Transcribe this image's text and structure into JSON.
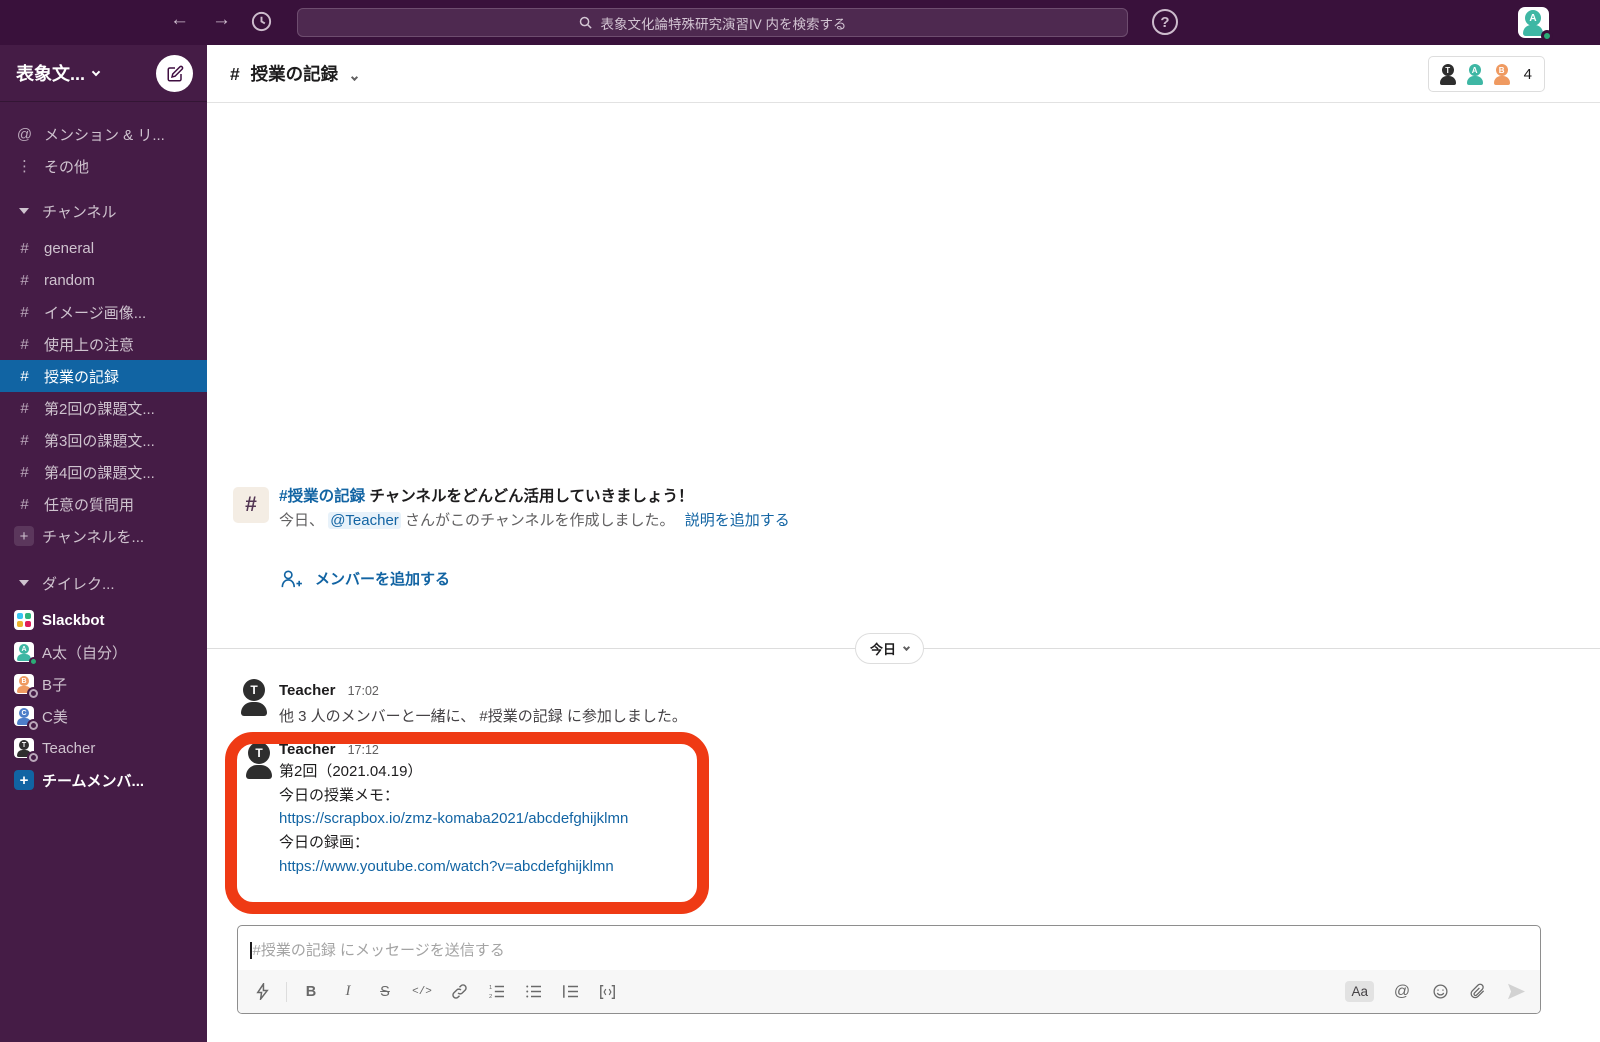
{
  "glyphs": {
    "hash": "#",
    "at": "@",
    "dots": "⋮",
    "plus": "+",
    "question": "?",
    "back": "←",
    "forward": "→",
    "bold": "B",
    "italic": "I",
    "strike": "S",
    "code": "</>"
  },
  "topbar": {
    "search_text": "表象文化論特殊研究演習IV 内を検索する",
    "avatar_letter": "A"
  },
  "sidebar": {
    "workspace_name": "表象文...",
    "mentions_label": "メンション & リ...",
    "more_label": "その他",
    "channels_section": "チャンネル",
    "channels": [
      {
        "label": "general"
      },
      {
        "label": "random"
      },
      {
        "label": "イメージ画像..."
      },
      {
        "label": "使用上の注意"
      },
      {
        "label": "授業の記録"
      },
      {
        "label": "第2回の課題文..."
      },
      {
        "label": "第3回の課題文..."
      },
      {
        "label": "第4回の課題文..."
      },
      {
        "label": "任意の質問用"
      }
    ],
    "add_channel_label": "チャンネルを...",
    "dm_section": "ダイレク...",
    "dms": [
      {
        "name": "Slackbot"
      },
      {
        "name": "A太（自分）",
        "letter": "A"
      },
      {
        "name": "B子",
        "letter": "B"
      },
      {
        "name": "C美",
        "letter": "C"
      },
      {
        "name": "Teacher",
        "letter": "T"
      }
    ],
    "add_member_label": "チームメンバ..."
  },
  "header": {
    "channel_name": "授業の記録",
    "member_count": "4",
    "member_letters": [
      "T",
      "A",
      "B"
    ]
  },
  "intro": {
    "channel_link": "#授業の記録",
    "title_rest": " チャンネルをどんどん活用していきましょう！",
    "desc_prefix": "今日、",
    "mention": "@Teacher",
    "desc_suffix": " さんがこのチャンネルを作成しました。",
    "add_description_link": "説明を追加する",
    "add_members_label": "メンバーを追加する"
  },
  "day_divider": {
    "label": "今日"
  },
  "messages": [
    {
      "author": "Teacher",
      "time": "17:02",
      "avatar_letter": "T",
      "text": "他 3 人のメンバーと一緒に、 #授業の記録 に参加しました。"
    },
    {
      "author": "Teacher",
      "time": "17:12",
      "avatar_letter": "T",
      "lines": [
        "第2回（2021.04.19）",
        "今日の授業メモ：",
        "https://scrapbox.io/zmz-komaba2021/abcdefghijklmn",
        "今日の録画：",
        "https://www.youtube.com/watch?v=abcdefghijklmn"
      ]
    }
  ],
  "composer": {
    "placeholder": "#授業の記録 にメッセージを送信する",
    "aa_label": "Aa"
  },
  "colors": {
    "topbar": "#39113B",
    "sidebar": "#451C46",
    "selected_blue": "#1164A3",
    "link_blue": "#1264A3",
    "annotation_red": "#EF3A14",
    "presence_green": "#2BAC76",
    "avatar_teal": "#3EB7A4",
    "avatar_orange": "#EF9A61",
    "avatar_blue": "#4D7EC9",
    "avatar_black": "#2E2E2E",
    "slackbot_colors": [
      "#36C5F0",
      "#2EB67D",
      "#ECB22E",
      "#E01E5A"
    ]
  }
}
